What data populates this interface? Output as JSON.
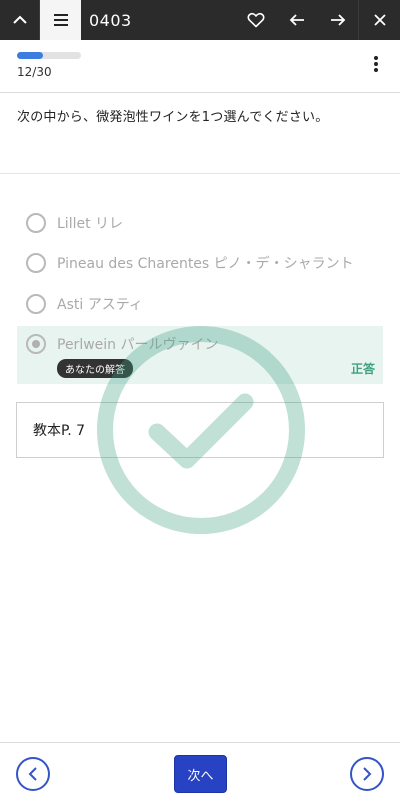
{
  "header": {
    "title": "0403",
    "icons": [
      "chevron-up-icon",
      "menu-icon",
      "heart-icon",
      "arrow-left-icon",
      "arrow-right-icon",
      "close-icon"
    ]
  },
  "progress": {
    "label": "12/30",
    "fraction": 0.4,
    "color": "#3c7de0"
  },
  "question": {
    "text": "次の中から、微発泡性ワインを1つ選んでください。"
  },
  "options": [
    {
      "label": "Lillet リレ",
      "selected": false
    },
    {
      "label": "Pineau des Charentes ピノ・デ・シャラント",
      "selected": false
    },
    {
      "label": "Asti アスティ",
      "selected": false
    },
    {
      "label": "Perlwein パールヴァイン",
      "selected": true
    }
  ],
  "answer": {
    "your_answer_badge": "あなたの解答",
    "result": "正答",
    "result_color": "#3ea07f",
    "highlight_color": "#e8f4f0"
  },
  "reference": {
    "text": "教本P. 7"
  },
  "footer": {
    "next_label": "次へ",
    "accent_color": "#2742c2"
  }
}
